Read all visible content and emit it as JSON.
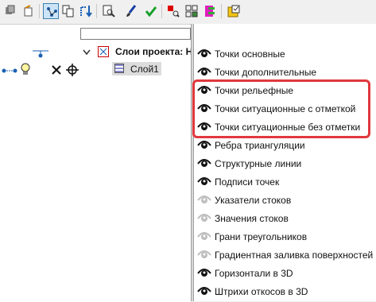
{
  "toolbar": {
    "icons": [
      "layers-stack-icon",
      "refresh-doc-icon",
      "view-tree-icon",
      "copy-icon",
      "route-icon",
      "preview-search-icon",
      "brush-icon",
      "checkmark-icon",
      "red-select-icon",
      "grid-icon",
      "palette-icon",
      "properties-icon"
    ]
  },
  "tree": {
    "filter_value": "",
    "project_label": "Слои проекта: Но",
    "layer_label": "Слой1"
  },
  "menu": {
    "items": [
      {
        "label": "Точки основные",
        "eye": "on"
      },
      {
        "label": "Точки дополнительные",
        "eye": "on"
      },
      {
        "label": "Точки рельефные",
        "eye": "on"
      },
      {
        "label": "Точки ситуационные с отметкой",
        "eye": "on"
      },
      {
        "label": "Точки ситуационные без отметки",
        "eye": "on"
      },
      {
        "label": "Ребра триангуляции",
        "eye": "on"
      },
      {
        "label": "Структурные линии",
        "eye": "on"
      },
      {
        "label": "Подписи точек",
        "eye": "on"
      },
      {
        "label": "Указатели стоков",
        "eye": "off"
      },
      {
        "label": "Значения стоков",
        "eye": "off"
      },
      {
        "label": "Грани треугольников",
        "eye": "off"
      },
      {
        "label": "Градиентная заливка поверхностей",
        "eye": "off"
      },
      {
        "label": "Горизонтали в 3D",
        "eye": "on"
      },
      {
        "label": "Штрихи откосов в 3D",
        "eye": "on"
      }
    ]
  },
  "colors": {
    "highlight": "#e0383e",
    "eye_on": "#111111",
    "eye_off": "#bdbdbd",
    "active_button_bg": "#cce4f7"
  }
}
